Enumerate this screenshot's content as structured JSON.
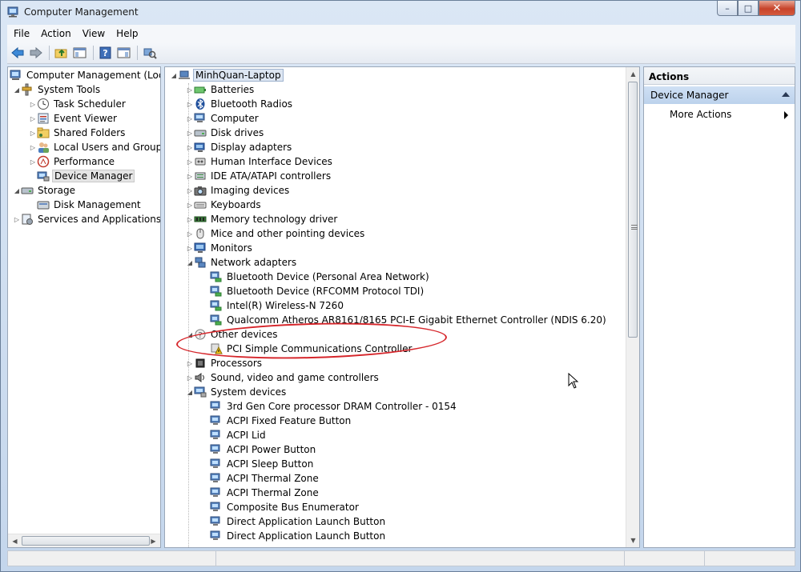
{
  "window": {
    "title": "Computer Management"
  },
  "menu": {
    "file": "File",
    "action": "Action",
    "view": "View",
    "help": "Help"
  },
  "left_tree": {
    "root": "Computer Management (Local",
    "system_tools": "System Tools",
    "task_scheduler": "Task Scheduler",
    "event_viewer": "Event Viewer",
    "shared_folders": "Shared Folders",
    "local_users": "Local Users and Groups",
    "performance": "Performance",
    "device_manager": "Device Manager",
    "storage": "Storage",
    "disk_management": "Disk Management",
    "services": "Services and Applications"
  },
  "device_tree": {
    "root": "MinhQuan-Laptop",
    "items": [
      {
        "label": "Batteries",
        "icon": "battery-icon"
      },
      {
        "label": "Bluetooth Radios",
        "icon": "bluetooth-icon"
      },
      {
        "label": "Computer",
        "icon": "computer-icon"
      },
      {
        "label": "Disk drives",
        "icon": "disk-drive-icon"
      },
      {
        "label": "Display adapters",
        "icon": "display-adapter-icon"
      },
      {
        "label": "Human Interface Devices",
        "icon": "hid-icon"
      },
      {
        "label": "IDE ATA/ATAPI controllers",
        "icon": "ide-controller-icon"
      },
      {
        "label": "Imaging devices",
        "icon": "camera-icon"
      },
      {
        "label": "Keyboards",
        "icon": "keyboard-icon"
      },
      {
        "label": "Memory technology driver",
        "icon": "memory-icon"
      },
      {
        "label": "Mice and other pointing devices",
        "icon": "mouse-icon"
      },
      {
        "label": "Monitors",
        "icon": "monitor-icon"
      },
      {
        "label": "Network adapters",
        "icon": "network-icon"
      }
    ],
    "network_children": [
      "Bluetooth Device (Personal Area Network)",
      "Bluetooth Device (RFCOMM Protocol TDI)",
      "Intel(R) Wireless-N 7260",
      "Qualcomm Atheros AR8161/8165 PCI-E Gigabit Ethernet Controller (NDIS 6.20)"
    ],
    "other_devices": "Other devices",
    "other_children": [
      "PCI Simple Communications Controller"
    ],
    "after_other": [
      {
        "label": "Processors",
        "icon": "processor-icon"
      },
      {
        "label": "Sound, video and game controllers",
        "icon": "sound-icon"
      },
      {
        "label": "System devices",
        "icon": "system-icon"
      }
    ],
    "system_children": [
      "3rd Gen Core processor DRAM Controller - 0154",
      "ACPI Fixed Feature Button",
      "ACPI Lid",
      "ACPI Power Button",
      "ACPI Sleep Button",
      "ACPI Thermal Zone",
      "ACPI Thermal Zone",
      "Composite Bus Enumerator",
      "Direct Application Launch Button",
      "Direct Application Launch Button"
    ]
  },
  "actions": {
    "header": "Actions",
    "section": "Device Manager",
    "more": "More Actions"
  },
  "colors": {
    "annotation": "#d6262b",
    "selection": "#e5e5e5",
    "actions_section": "#c7daf0"
  }
}
